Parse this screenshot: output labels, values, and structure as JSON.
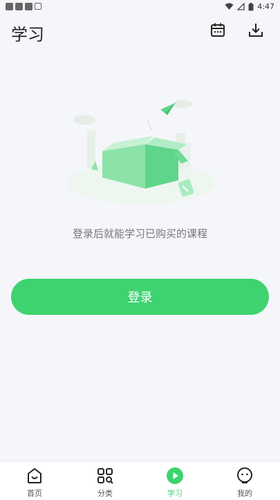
{
  "status_bar": {
    "time": "4:47"
  },
  "header": {
    "title": "学习",
    "calendar_icon": "calendar-icon",
    "download_icon": "download-icon"
  },
  "main": {
    "empty_message": "登录后就能学习已购买的课程",
    "login_label": "登录",
    "accent_color": "#3ed36f"
  },
  "tabbar": {
    "tabs": [
      {
        "label": "首页",
        "icon": "home-icon"
      },
      {
        "label": "分类",
        "icon": "category-icon"
      },
      {
        "label": "学习",
        "icon": "play-icon",
        "active": true
      },
      {
        "label": "我的",
        "icon": "profile-icon"
      }
    ]
  }
}
